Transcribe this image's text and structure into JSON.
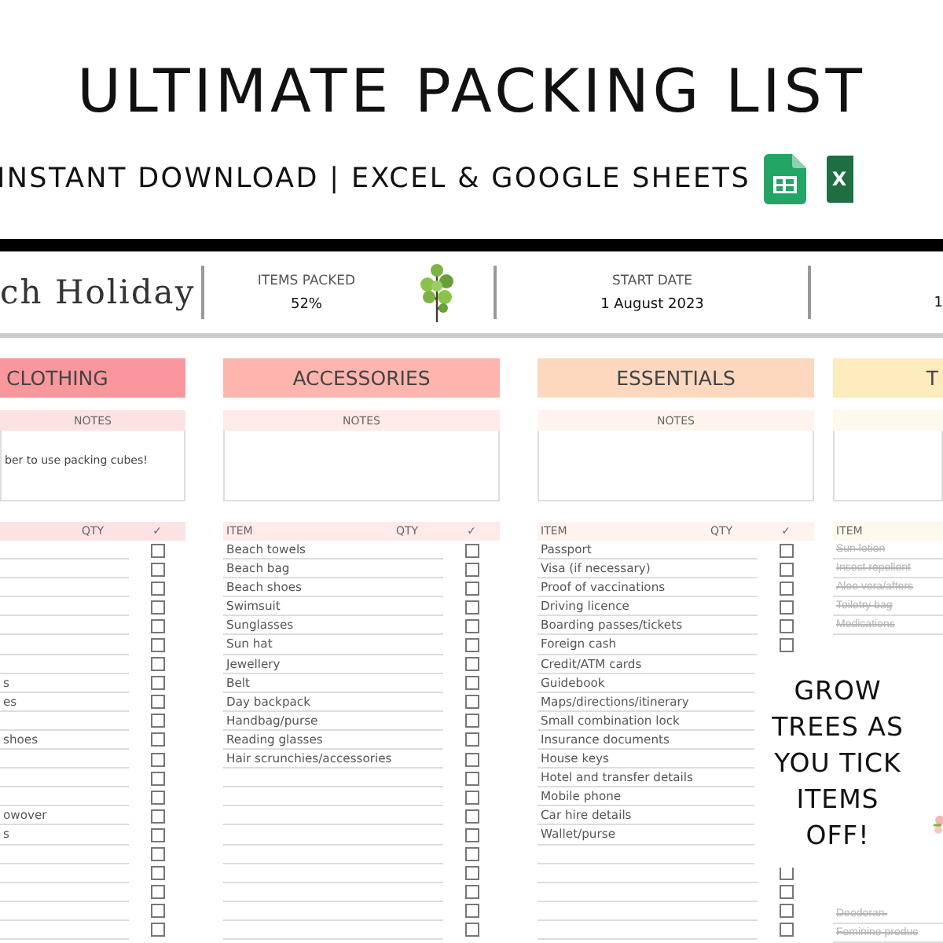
{
  "banner": {
    "title": "ULTIMATE PACKING LIST",
    "subtitle": "INSTANT DOWNLOAD | EXCEL & GOOGLE SHEETS",
    "excel_letter": "X"
  },
  "summary": {
    "list_title": "ch Holiday",
    "packed_label": "ITEMS PACKED",
    "packed_value": "52%",
    "start_label": "START DATE",
    "start_value": "1 August 2023",
    "end_value_fragment": "1"
  },
  "categories": [
    {
      "kind": "cut-left",
      "title": "CLOTHING",
      "color": "#f9979d",
      "notes_label": "NOTES",
      "notes": "ber to use packing cubes!",
      "qty_label": "QTY",
      "tick_label": "✓",
      "rows": [
        {
          "checked": false
        },
        {
          "checked": false
        },
        {
          "checked": false
        },
        {
          "checked": false
        },
        {
          "checked": false
        },
        {
          "checked": false
        },
        {
          "checked": false
        },
        {
          "item": "s",
          "checked": false
        },
        {
          "item": "es",
          "checked": false
        },
        {
          "checked": false
        },
        {
          "item": "shoes",
          "checked": false
        },
        {
          "checked": false
        },
        {
          "checked": false
        },
        {
          "checked": false
        },
        {
          "item": "owover",
          "checked": false
        },
        {
          "item": "s",
          "checked": false
        },
        {
          "checked": false
        },
        {
          "checked": false
        },
        {
          "checked": false
        },
        {
          "checked": false
        },
        {
          "checked": false
        }
      ]
    },
    {
      "kind": "list",
      "title": "ACCESSORIES",
      "color": "#fdb5ad",
      "notes_label": "NOTES",
      "item_label": "ITEM",
      "qty_label": "QTY",
      "tick_label": "✓",
      "rows": [
        {
          "item": "Beach towels",
          "checked": false
        },
        {
          "item": "Beach bag",
          "checked": false
        },
        {
          "item": "Beach shoes",
          "checked": false
        },
        {
          "item": "Swimsuit",
          "checked": false
        },
        {
          "item": "Sunglasses",
          "checked": false
        },
        {
          "item": "Sun hat",
          "checked": false
        },
        {
          "item": "Jewellery",
          "checked": false
        },
        {
          "item": "Belt",
          "checked": false
        },
        {
          "item": "Day backpack",
          "checked": false
        },
        {
          "item": "Handbag/purse",
          "checked": false
        },
        {
          "item": "Reading glasses",
          "checked": false
        },
        {
          "item": "Hair scrunchies/accessories",
          "checked": false
        },
        {
          "checked": false
        },
        {
          "checked": false
        },
        {
          "checked": false
        },
        {
          "checked": false
        },
        {
          "checked": false
        },
        {
          "checked": false
        },
        {
          "checked": false
        },
        {
          "checked": false
        },
        {
          "checked": false
        }
      ]
    },
    {
      "kind": "list",
      "title": "ESSENTIALS",
      "color": "#fdd8bf",
      "notes_label": "NOTES",
      "item_label": "ITEM",
      "qty_label": "QTY",
      "tick_label": "✓",
      "rows": [
        {
          "item": "Passport",
          "checked": false
        },
        {
          "item": "Visa (if necessary)",
          "checked": false
        },
        {
          "item": "Proof of vaccinations",
          "checked": false
        },
        {
          "item": "Driving licence",
          "checked": false
        },
        {
          "item": "Boarding passes/tickets",
          "checked": false
        },
        {
          "item": "Foreign cash",
          "checked": false
        },
        {
          "item": "Credit/ATM cards"
        },
        {
          "item": "Guidebook"
        },
        {
          "item": "Maps/directions/itinerary"
        },
        {
          "item": "Small combination lock"
        },
        {
          "item": "Insurance documents"
        },
        {
          "item": "House keys"
        },
        {
          "item": "Hotel and transfer details"
        },
        {
          "item": "Mobile phone"
        },
        {
          "item": "Car hire details"
        },
        {
          "item": "Wallet/purse"
        },
        {},
        {
          "checked": false
        },
        {
          "checked": false
        },
        {
          "checked": false
        },
        {
          "checked": false
        }
      ]
    },
    {
      "kind": "cut-right",
      "title": "T",
      "color": "#fdeabd",
      "item_label": "ITEM",
      "rows_top": [
        {
          "item": "Sun lotion",
          "checked": true
        },
        {
          "item": "Insect repellent",
          "checked": true
        },
        {
          "item": "Aloe vera/afters",
          "checked": true
        },
        {
          "item": "Toiletry bag",
          "checked": true
        },
        {
          "item": "Medications",
          "checked": true
        }
      ],
      "rows_bottom": [
        {
          "item": "Deodoran.",
          "checked": true
        },
        {
          "item": "Feminine produc",
          "checked": true
        }
      ]
    }
  ],
  "promo": {
    "lines": [
      "GROW",
      "TREES AS",
      "YOU TICK",
      "ITEMS",
      "OFF!"
    ]
  }
}
